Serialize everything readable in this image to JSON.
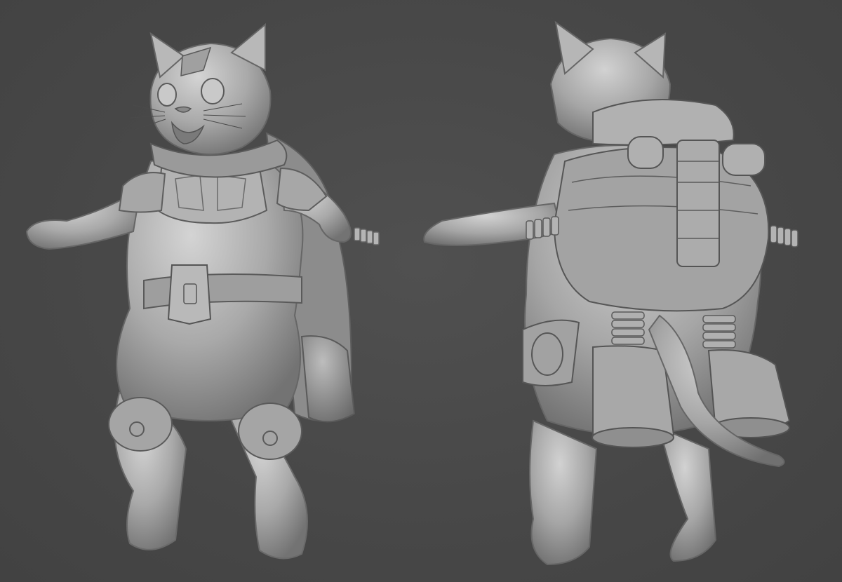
{
  "scene": {
    "background_color": "#4a4a4a",
    "material_base": "#a8a8a8",
    "material_light": "#cfcfcf",
    "material_shadow": "#6e6e6e",
    "views": [
      {
        "name": "front-view"
      },
      {
        "name": "back-view"
      }
    ]
  }
}
